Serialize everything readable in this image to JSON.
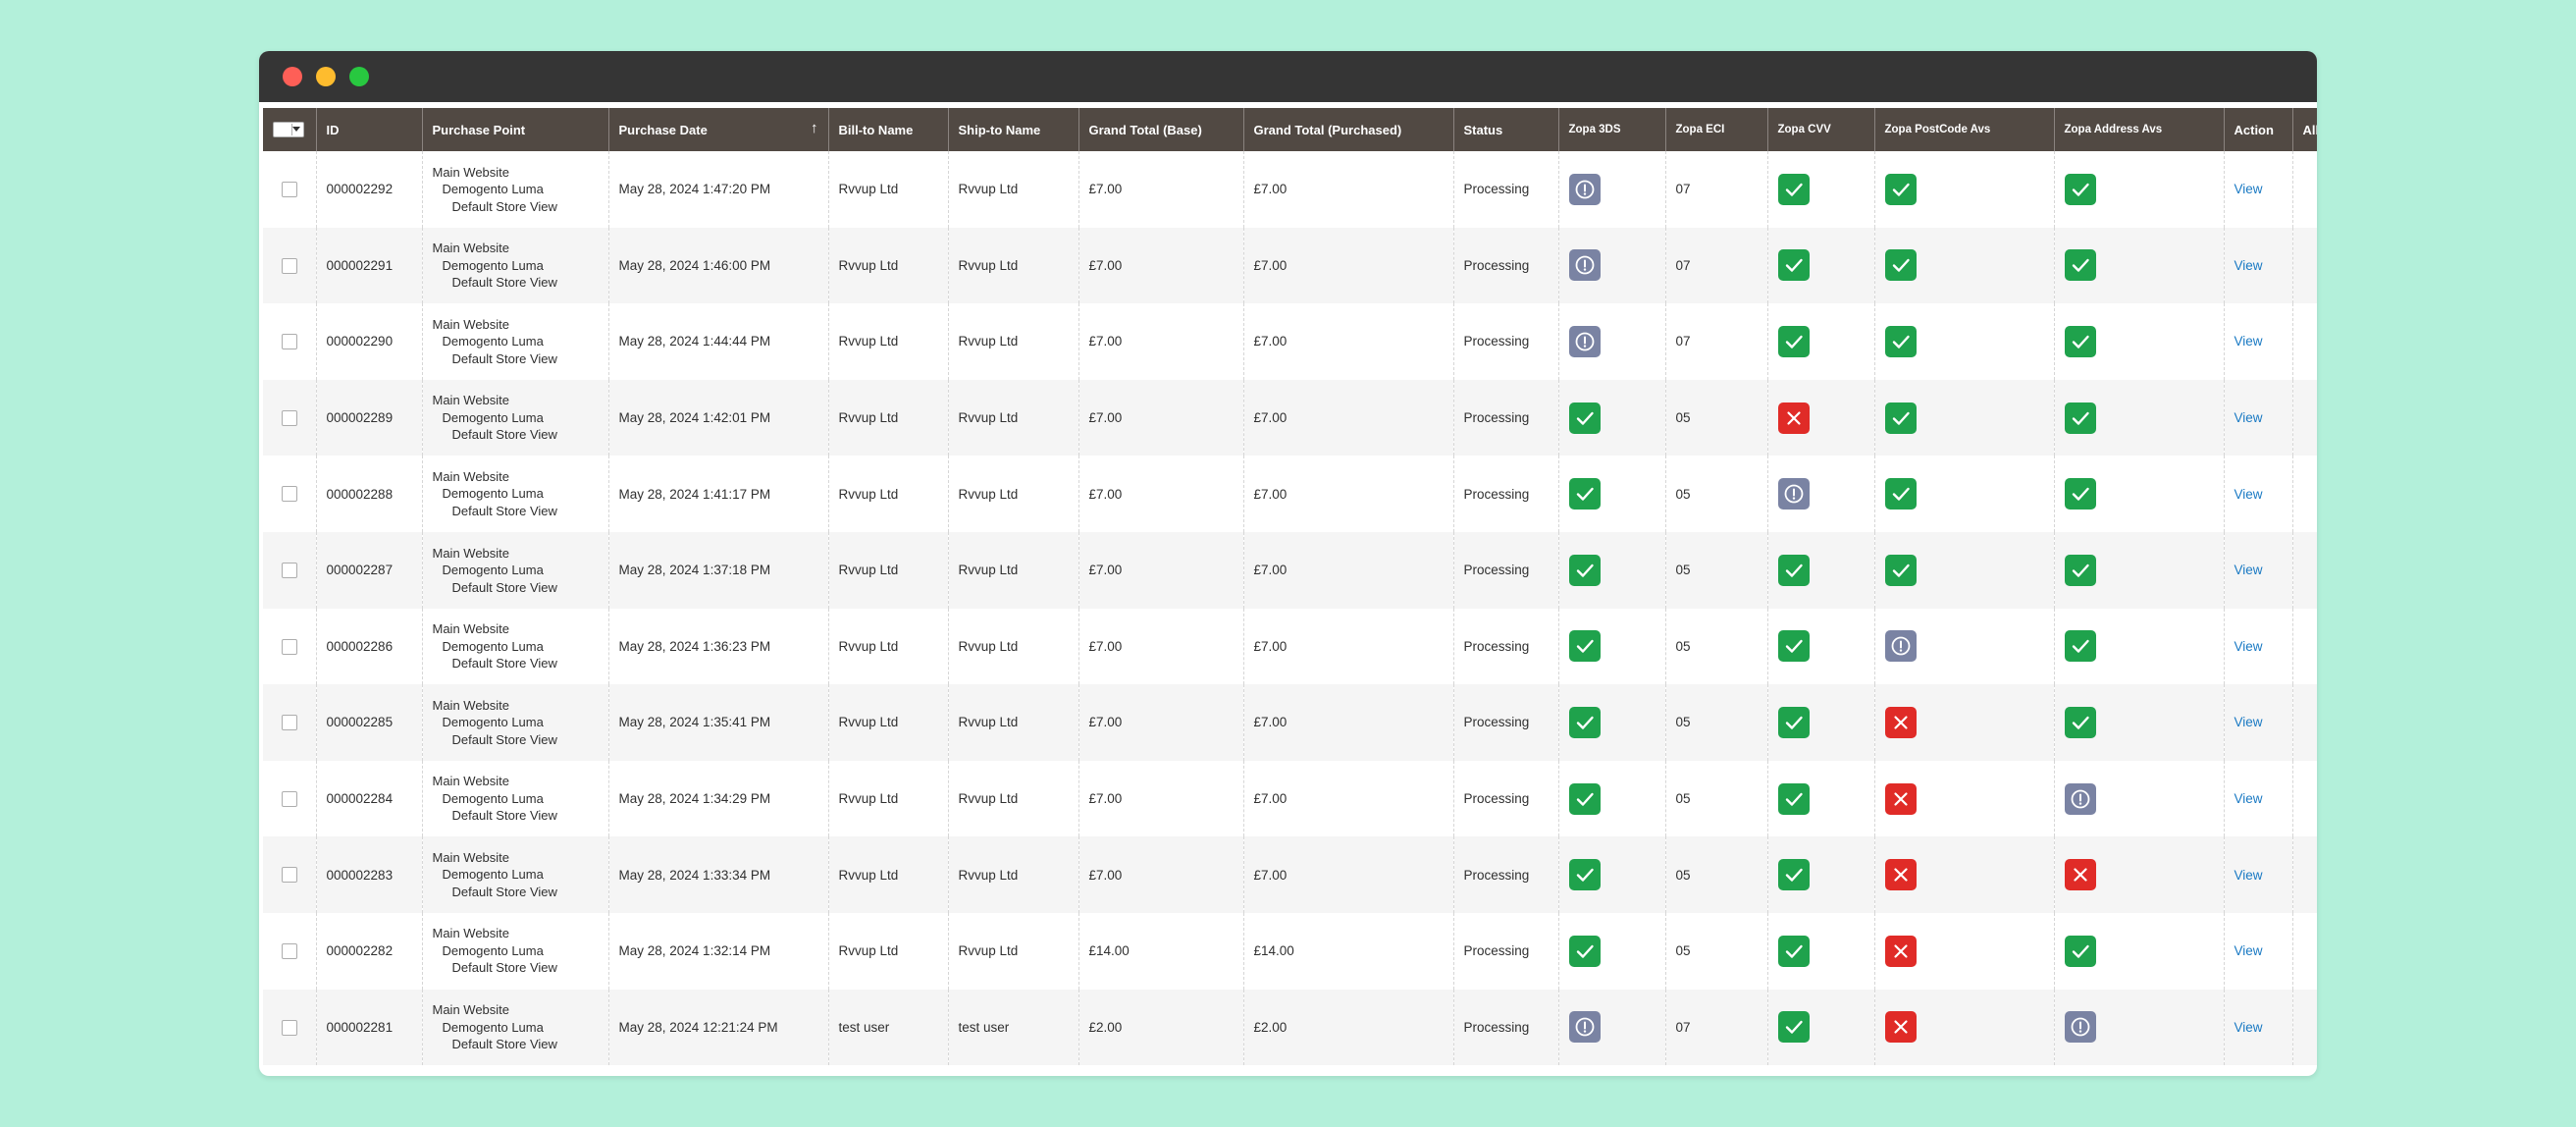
{
  "window": {
    "controls": [
      "close",
      "minimize",
      "maximize"
    ]
  },
  "grid": {
    "columns": [
      {
        "key": "select",
        "label": ""
      },
      {
        "key": "id",
        "label": "ID"
      },
      {
        "key": "purchase_point",
        "label": "Purchase Point"
      },
      {
        "key": "purchase_date",
        "label": "Purchase Date",
        "sort": "↑"
      },
      {
        "key": "bill_to",
        "label": "Bill-to Name"
      },
      {
        "key": "ship_to",
        "label": "Ship-to Name"
      },
      {
        "key": "grand_total_base",
        "label": "Grand Total (Base)"
      },
      {
        "key": "grand_total_purchased",
        "label": "Grand Total (Purchased)"
      },
      {
        "key": "status",
        "label": "Status"
      },
      {
        "key": "zopa_3ds",
        "label": "Zopa 3DS"
      },
      {
        "key": "zopa_eci",
        "label": "Zopa ECI"
      },
      {
        "key": "zopa_cvv",
        "label": "Zopa CVV"
      },
      {
        "key": "zopa_postcode",
        "label": "Zopa PostCode Avs"
      },
      {
        "key": "zopa_address",
        "label": "Zopa Address Avs"
      },
      {
        "key": "action",
        "label": "Action"
      },
      {
        "key": "allocated",
        "label": "All"
      }
    ],
    "purchase_point": [
      "Main Website",
      "Demogento Luma",
      "Default Store View"
    ],
    "action_label": "View",
    "status_colors": {
      "ok": "#1fa24c",
      "fail": "#e02b27",
      "info": "#7a83a3"
    },
    "rows": [
      {
        "id": "000002292",
        "date": "May 28, 2024 1:47:20 PM",
        "bill": "Rvvup Ltd",
        "ship": "Rvvup Ltd",
        "base": "£7.00",
        "purchased": "£7.00",
        "status": "Processing",
        "tds": "info",
        "eci": "07",
        "cvv": "ok",
        "postcode": "ok",
        "address": "ok"
      },
      {
        "id": "000002291",
        "date": "May 28, 2024 1:46:00 PM",
        "bill": "Rvvup Ltd",
        "ship": "Rvvup Ltd",
        "base": "£7.00",
        "purchased": "£7.00",
        "status": "Processing",
        "tds": "info",
        "eci": "07",
        "cvv": "ok",
        "postcode": "ok",
        "address": "ok"
      },
      {
        "id": "000002290",
        "date": "May 28, 2024 1:44:44 PM",
        "bill": "Rvvup Ltd",
        "ship": "Rvvup Ltd",
        "base": "£7.00",
        "purchased": "£7.00",
        "status": "Processing",
        "tds": "info",
        "eci": "07",
        "cvv": "ok",
        "postcode": "ok",
        "address": "ok"
      },
      {
        "id": "000002289",
        "date": "May 28, 2024 1:42:01 PM",
        "bill": "Rvvup Ltd",
        "ship": "Rvvup Ltd",
        "base": "£7.00",
        "purchased": "£7.00",
        "status": "Processing",
        "tds": "ok",
        "eci": "05",
        "cvv": "fail",
        "postcode": "ok",
        "address": "ok"
      },
      {
        "id": "000002288",
        "date": "May 28, 2024 1:41:17 PM",
        "bill": "Rvvup Ltd",
        "ship": "Rvvup Ltd",
        "base": "£7.00",
        "purchased": "£7.00",
        "status": "Processing",
        "tds": "ok",
        "eci": "05",
        "cvv": "info",
        "postcode": "ok",
        "address": "ok"
      },
      {
        "id": "000002287",
        "date": "May 28, 2024 1:37:18 PM",
        "bill": "Rvvup Ltd",
        "ship": "Rvvup Ltd",
        "base": "£7.00",
        "purchased": "£7.00",
        "status": "Processing",
        "tds": "ok",
        "eci": "05",
        "cvv": "ok",
        "postcode": "ok",
        "address": "ok"
      },
      {
        "id": "000002286",
        "date": "May 28, 2024 1:36:23 PM",
        "bill": "Rvvup Ltd",
        "ship": "Rvvup Ltd",
        "base": "£7.00",
        "purchased": "£7.00",
        "status": "Processing",
        "tds": "ok",
        "eci": "05",
        "cvv": "ok",
        "postcode": "info",
        "address": "ok"
      },
      {
        "id": "000002285",
        "date": "May 28, 2024 1:35:41 PM",
        "bill": "Rvvup Ltd",
        "ship": "Rvvup Ltd",
        "base": "£7.00",
        "purchased": "£7.00",
        "status": "Processing",
        "tds": "ok",
        "eci": "05",
        "cvv": "ok",
        "postcode": "fail",
        "address": "ok"
      },
      {
        "id": "000002284",
        "date": "May 28, 2024 1:34:29 PM",
        "bill": "Rvvup Ltd",
        "ship": "Rvvup Ltd",
        "base": "£7.00",
        "purchased": "£7.00",
        "status": "Processing",
        "tds": "ok",
        "eci": "05",
        "cvv": "ok",
        "postcode": "fail",
        "address": "info"
      },
      {
        "id": "000002283",
        "date": "May 28, 2024 1:33:34 PM",
        "bill": "Rvvup Ltd",
        "ship": "Rvvup Ltd",
        "base": "£7.00",
        "purchased": "£7.00",
        "status": "Processing",
        "tds": "ok",
        "eci": "05",
        "cvv": "ok",
        "postcode": "fail",
        "address": "fail"
      },
      {
        "id": "000002282",
        "date": "May 28, 2024 1:32:14 PM",
        "bill": "Rvvup Ltd",
        "ship": "Rvvup Ltd",
        "base": "£14.00",
        "purchased": "£14.00",
        "status": "Processing",
        "tds": "ok",
        "eci": "05",
        "cvv": "ok",
        "postcode": "fail",
        "address": "ok"
      },
      {
        "id": "000002281",
        "date": "May 28, 2024 12:21:24 PM",
        "bill": "test user",
        "ship": "test user",
        "base": "£2.00",
        "purchased": "£2.00",
        "status": "Processing",
        "tds": "info",
        "eci": "07",
        "cvv": "ok",
        "postcode": "fail",
        "address": "info"
      }
    ]
  }
}
